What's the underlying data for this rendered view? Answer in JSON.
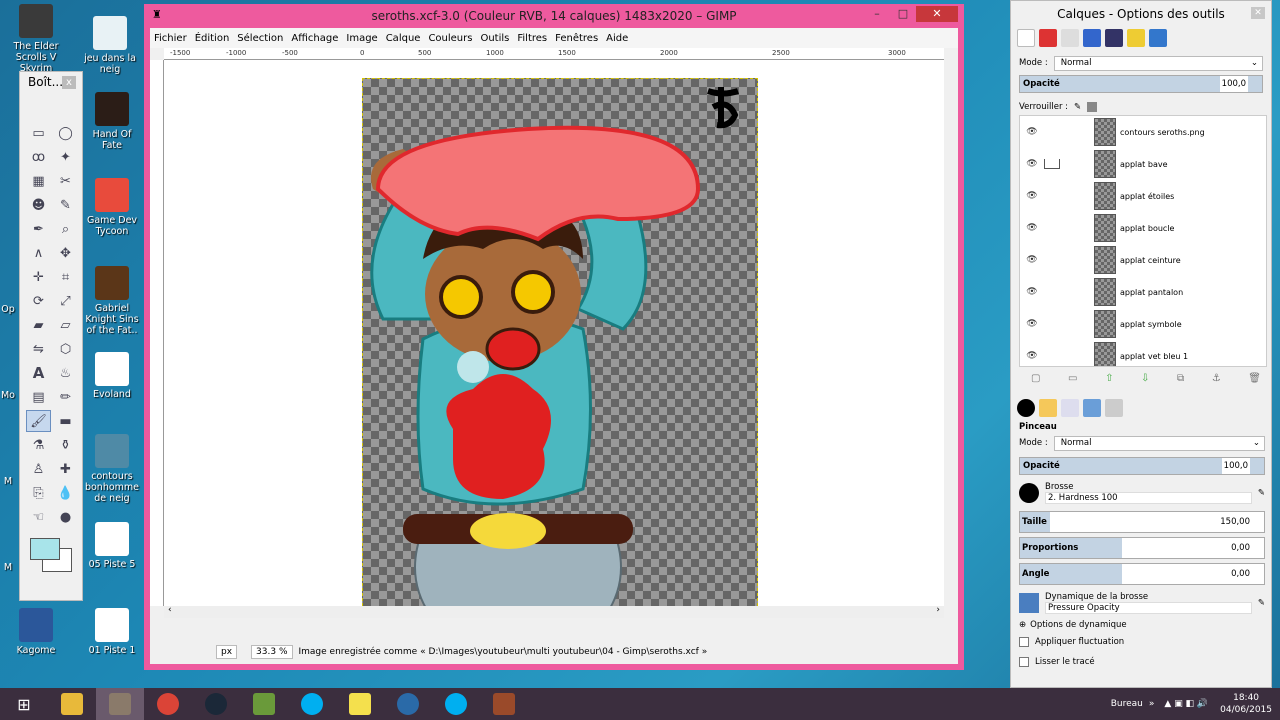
{
  "desktop_icons": [
    {
      "label": "The Elder Scrolls V Skyrim",
      "color": "#3a3a3a"
    },
    {
      "label": "jeu dans la neig",
      "color": "#e8f2f5"
    },
    {
      "label": "Hand Of Fate",
      "color": "#2b1d17"
    },
    {
      "label": "Game Dev Tycoon",
      "color": "#e84b3c"
    },
    {
      "label": "Gabriel Knight Sins of the Fat..",
      "color": "#5b3618"
    },
    {
      "label": "Evoland",
      "color": "#ffffff"
    },
    {
      "label": "contours bonhomme de neig",
      "color": "#4f8aa6"
    },
    {
      "label": "05 Piste 5",
      "color": "#ffffff"
    },
    {
      "label": "Kagome",
      "color": "#2b579a"
    },
    {
      "label": "01 Piste 1",
      "color": "#ffffff"
    }
  ],
  "left_partial_labels": [
    "Op",
    "Mo",
    "M",
    "M"
  ],
  "gimp": {
    "title": "seroths.xcf-3.0 (Couleur RVB, 14 calques) 1483x2020 – GIMP",
    "menu": [
      "Fichier",
      "Édition",
      "Sélection",
      "Affichage",
      "Image",
      "Calque",
      "Couleurs",
      "Outils",
      "Filtres",
      "Fenêtres",
      "Aide"
    ],
    "ruler_ticks": [
      "-1500",
      "-1000",
      "-500",
      "0",
      "500",
      "1000",
      "1500",
      "2000",
      "2500",
      "3000"
    ],
    "unit": "px",
    "zoom": "33.3 %",
    "status": "Image enregistrée comme « D:\\Images\\youtubeur\\multi youtubeur\\04 - Gimp\\seroths.xcf »"
  },
  "toolbox": {
    "title": "Boît...",
    "close": "x"
  },
  "dock": {
    "title": "Calques - Options des outils",
    "mode_label": "Mode :",
    "mode_value": "Normal",
    "opacity_label": "Opacité",
    "opacity_value": "100,0",
    "lock_label": "Verrouiller :",
    "layers": [
      {
        "name": "contours seroths.png",
        "visible": true
      },
      {
        "name": "applat bave",
        "visible": true
      },
      {
        "name": "applat étoiles",
        "visible": true
      },
      {
        "name": "applat boucle",
        "visible": true
      },
      {
        "name": "applat ceinture",
        "visible": true
      },
      {
        "name": "applat pantalon",
        "visible": true
      },
      {
        "name": "applat symbole",
        "visible": true
      },
      {
        "name": "applat vet bleu 1",
        "visible": true
      }
    ],
    "tool": {
      "name": "Pinceau",
      "mode_label": "Mode :",
      "mode_value": "Normal",
      "opacity_label": "Opacité",
      "opacity_value": "100,0",
      "brush_label": "Brosse",
      "brush_value": "2. Hardness 100",
      "size_label": "Taille",
      "size_value": "150,00",
      "ratio_label": "Proportions",
      "ratio_value": "0,00",
      "angle_label": "Angle",
      "angle_value": "0,00",
      "dynamics_label": "Dynamique de la brosse",
      "dynamics_value": "Pressure Opacity",
      "dyn_options": "Options de dynamique",
      "fluct": "Appliquer fluctuation",
      "smooth": "Lisser le tracé"
    }
  },
  "taskbar": {
    "apps": [
      {
        "name": "explorer",
        "color": "#e8b93a"
      },
      {
        "name": "gimp",
        "color": "#8a7a6a"
      },
      {
        "name": "chrome",
        "color": "#db4437"
      },
      {
        "name": "steam",
        "color": "#1b2838"
      },
      {
        "name": "minecraft",
        "color": "#6a9a3a"
      },
      {
        "name": "skype",
        "color": "#00aff0"
      },
      {
        "name": "notes",
        "color": "#f4e04d"
      },
      {
        "name": "media",
        "color": "#2a6aa8"
      },
      {
        "name": "skype-2",
        "color": "#00aff0"
      },
      {
        "name": "screen",
        "color": "#9a4a2a"
      }
    ],
    "tray_label": "Bureau",
    "time": "18:40",
    "date": "04/06/2015"
  }
}
